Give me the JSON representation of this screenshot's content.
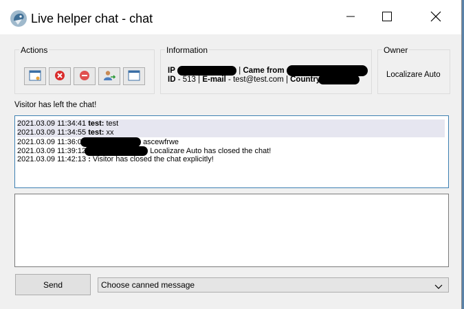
{
  "window": {
    "title": "Live helper chat - chat",
    "controls": [
      "minimize-icon",
      "maximize-icon",
      "close-icon"
    ]
  },
  "actions": {
    "label": "Actions",
    "buttons": [
      "window-icon",
      "close-chat-icon",
      "block-user-icon",
      "transfer-user-icon",
      "popup-window-icon"
    ]
  },
  "information": {
    "label": "Information",
    "ip_label": "IP",
    "came_from_label": "Came from",
    "id_label": "ID",
    "id_value": "513",
    "email_label": "E-mail",
    "email_value": "test@test.com",
    "country_label": "Country"
  },
  "owner": {
    "label": "Owner",
    "value": "Localizare Auto"
  },
  "status": "Visitor has left the chat!",
  "chat_log": [
    {
      "time": "2021.03.09 11:34:41",
      "author": "test:",
      "text": "test"
    },
    {
      "time": "2021.03.09 11:34:55",
      "author": "test:",
      "text": "xx"
    },
    {
      "time": "2021.03.09 11:36:0",
      "author": "",
      "text": "ascewfrwe"
    },
    {
      "time": "2021.03.09 11:39:12",
      "author": "",
      "text": "Localizare Auto has closed the chat!"
    },
    {
      "time": "2021.03.09 11:42:13",
      "author": ":",
      "text": "Visitor has closed the chat explicitly!"
    }
  ],
  "composer": {
    "send_label": "Send",
    "canned_placeholder": "Choose canned message"
  },
  "colors": {
    "accent": "#3c7fb1",
    "selected_row": "#e6e6f0"
  }
}
